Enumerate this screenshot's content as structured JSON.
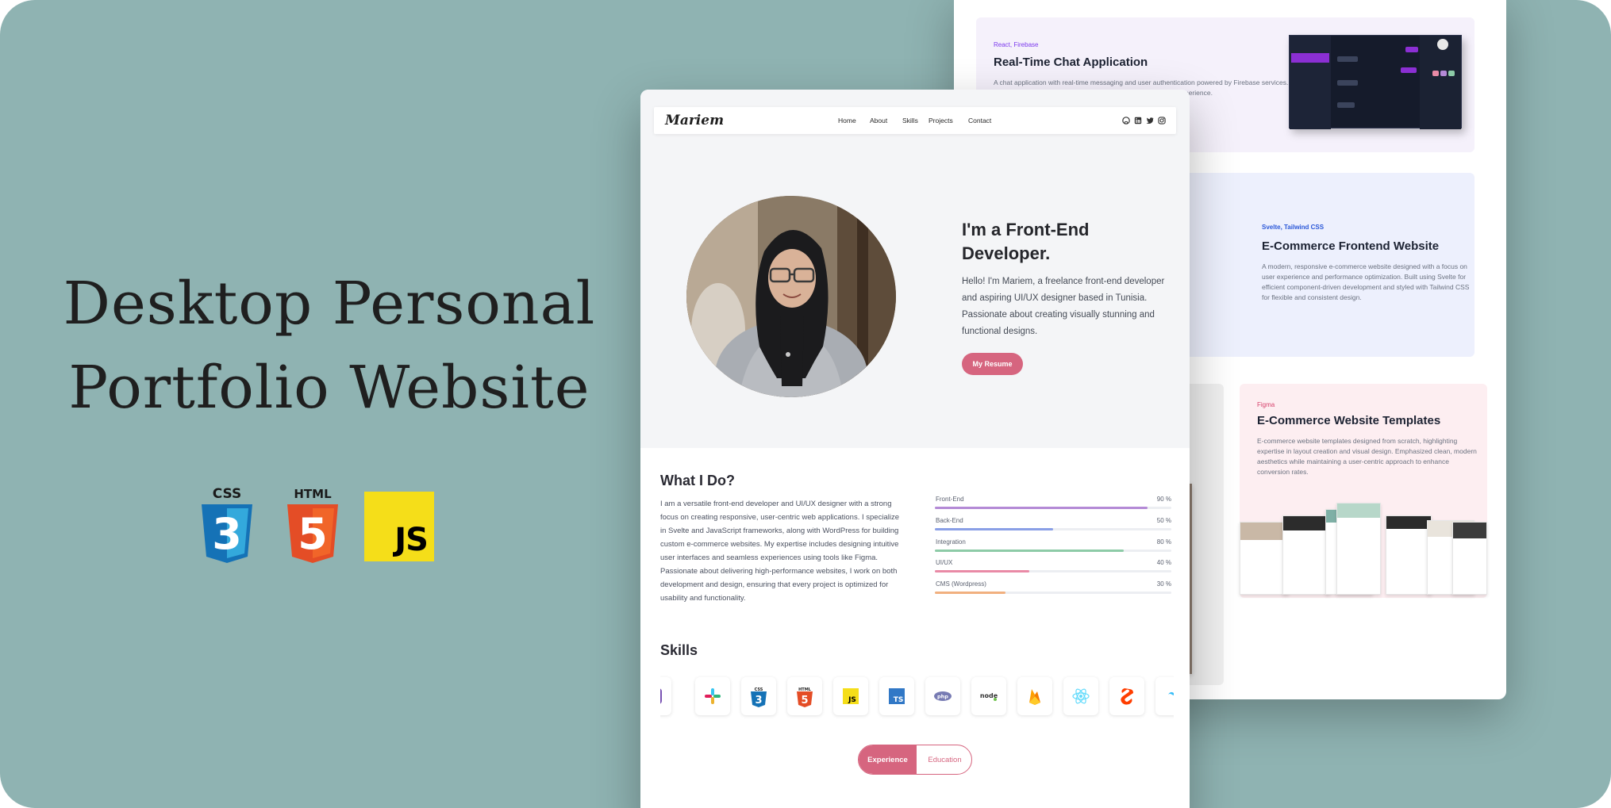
{
  "hero": {
    "title_line1": "Desktop Personal",
    "title_line2": "Portfolio Website",
    "tech_logos": [
      "css3-logo",
      "html5-logo",
      "javascript-logo"
    ],
    "css_label": "CSS",
    "html_label": "HTML",
    "js_label": "JS"
  },
  "projects": [
    {
      "tags": "React, Firebase",
      "title": "Real-Time Chat Application",
      "description": "A chat application with real-time messaging and user authentication powered by Firebase services. It features a responsive interface designed for a seamless user experience."
    },
    {
      "tags": "Svelte, Tailwind CSS",
      "title": "E-Commerce Frontend Website",
      "description": "A modern, responsive e-commerce website designed with a focus on user experience and performance optimization. Built using Svelte for efficient component-driven development and styled with Tailwind CSS for flexible and consistent design."
    },
    {
      "tags": "Figma",
      "title": "E-Commerce Website Templates",
      "description": "E-commerce website templates designed from scratch, highlighting expertise in layout creation and visual design. Emphasized clean, modern aesthetics while maintaining a user-centric approach to enhance conversion rates."
    }
  ],
  "portfolio": {
    "brand": "Mariem",
    "nav": {
      "home": "Home",
      "about": "About",
      "skills": "Skills",
      "projects": "Projects",
      "contact": "Contact"
    },
    "social_icons": [
      "github-icon",
      "linkedin-icon",
      "twitter-icon",
      "instagram-icon"
    ],
    "intro_heading": "I'm a Front-End Developer.",
    "intro_text": "Hello! I'm Mariem, a freelance front-end developer and aspiring UI/UX designer based in Tunisia. Passionate about creating visually stunning and functional designs.",
    "resume_button": "My Resume",
    "whatido_title": "What I Do?",
    "whatido_text": "I am a versatile front-end developer and UI/UX designer with a strong focus on creating responsive, user-centric web applications. I specialize in Svelte and JavaScript frameworks, along with WordPress for building custom e-commerce websites. My expertise includes designing intuitive user interfaces and seamless experiences using tools like Figma. Passionate about delivering high-performance websites, I work on both development and design, ensuring that every project is optimized for usability and functionality.",
    "skill_bars": [
      {
        "label": "Front-End",
        "value": "90 %",
        "percent": 90,
        "color": "#b48ad6"
      },
      {
        "label": "Back-End",
        "value": "50 %",
        "percent": 50,
        "color": "#8a9fe6"
      },
      {
        "label": "Integration",
        "value": "80 %",
        "percent": 80,
        "color": "#8dcba7"
      },
      {
        "label": "UI/UX",
        "value": "40 %",
        "percent": 40,
        "color": "#e98aa6"
      },
      {
        "label": "CMS (Wordpress)",
        "value": "30 %",
        "percent": 30,
        "color": "#f1b07f"
      }
    ],
    "skills_title": "Skills",
    "skill_icons": [
      "bootstrap-icon",
      "slack-icon",
      "css3-icon",
      "html5-icon",
      "javascript-icon",
      "typescript-icon",
      "php-icon",
      "nodejs-icon",
      "firebase-icon",
      "react-icon",
      "svelte-icon",
      "tailwind-icon"
    ],
    "skill_icon_text": {
      "css": "CSS",
      "html": "HTML",
      "js": "JS",
      "ts": "TS",
      "php": "php",
      "node": "node"
    },
    "tabs": {
      "experience": "Experience",
      "education": "Education"
    }
  },
  "colors": {
    "background": "#8fb3b2",
    "accent": "#d6657f"
  }
}
